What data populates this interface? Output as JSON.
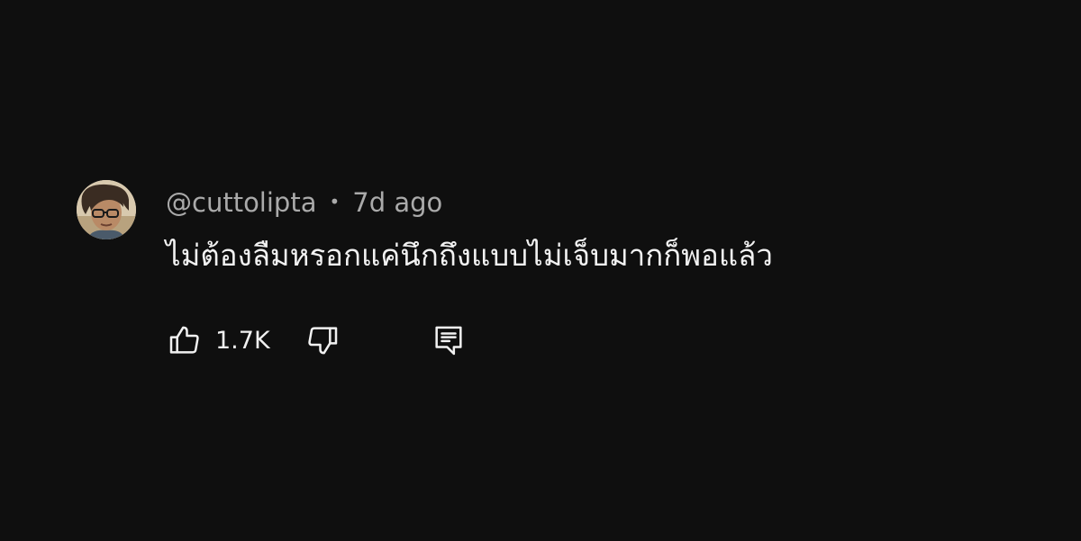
{
  "comment": {
    "author": "@cuttolipta",
    "separator": "•",
    "timestamp": "7d ago",
    "text": "ไม่ต้องลืมหรอกแค่นึกถึงแบบไม่เจ็บมากก็พอแล้ว",
    "like_count": "1.7K"
  },
  "icons": {
    "like": "thumbs-up-icon",
    "dislike": "thumbs-down-icon",
    "reply": "comment-reply-icon"
  },
  "colors": {
    "background": "#0f0f0f",
    "text_primary": "#f1f1f1",
    "text_secondary": "#aaaaaa"
  }
}
